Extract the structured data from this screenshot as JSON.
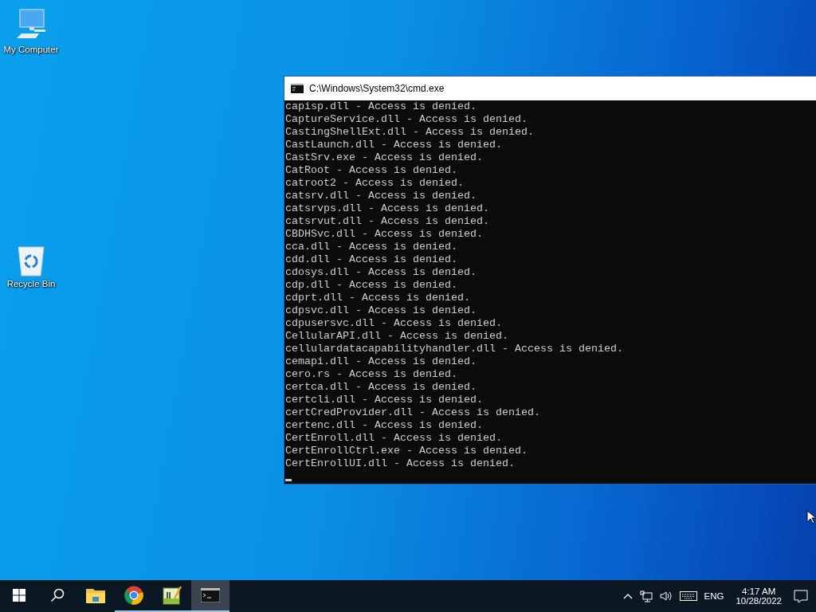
{
  "desktop_icons": [
    {
      "kind": "computer",
      "label": "My Computer"
    },
    {
      "kind": "recycle",
      "label": "Recycle Bin"
    }
  ],
  "window": {
    "title": "C:\\Windows\\System32\\cmd.exe",
    "lines": [
      "capisp.dll - Access is denied.",
      "CaptureService.dll - Access is denied.",
      "CastingShellExt.dll - Access is denied.",
      "CastLaunch.dll - Access is denied.",
      "CastSrv.exe - Access is denied.",
      "CatRoot - Access is denied.",
      "catroot2 - Access is denied.",
      "catsrv.dll - Access is denied.",
      "catsrvps.dll - Access is denied.",
      "catsrvut.dll - Access is denied.",
      "CBDHSvc.dll - Access is denied.",
      "cca.dll - Access is denied.",
      "cdd.dll - Access is denied.",
      "cdosys.dll - Access is denied.",
      "cdp.dll - Access is denied.",
      "cdprt.dll - Access is denied.",
      "cdpsvc.dll - Access is denied.",
      "cdpusersvc.dll - Access is denied.",
      "CellularAPI.dll - Access is denied.",
      "cellulardatacapabilityhandler.dll - Access is denied.",
      "cemapi.dll - Access is denied.",
      "cero.rs - Access is denied.",
      "certca.dll - Access is denied.",
      "certcli.dll - Access is denied.",
      "certCredProvider.dll - Access is denied.",
      "certenc.dll - Access is denied.",
      "CertEnroll.dll - Access is denied.",
      "CertEnrollCtrl.exe - Access is denied.",
      "CertEnrollUI.dll - Access is denied."
    ]
  },
  "taskbar": {
    "apps": [
      {
        "kind": "start",
        "running": false,
        "selected": false
      },
      {
        "kind": "search",
        "running": false,
        "selected": false
      },
      {
        "kind": "folder",
        "running": false,
        "selected": false
      },
      {
        "kind": "browser",
        "running": true,
        "selected": false
      },
      {
        "kind": "notepad",
        "running": true,
        "selected": false
      },
      {
        "kind": "console",
        "running": true,
        "selected": true
      }
    ],
    "tray": {
      "language": "ENG",
      "time": "4:17 AM",
      "date": "10/28/2022"
    }
  }
}
